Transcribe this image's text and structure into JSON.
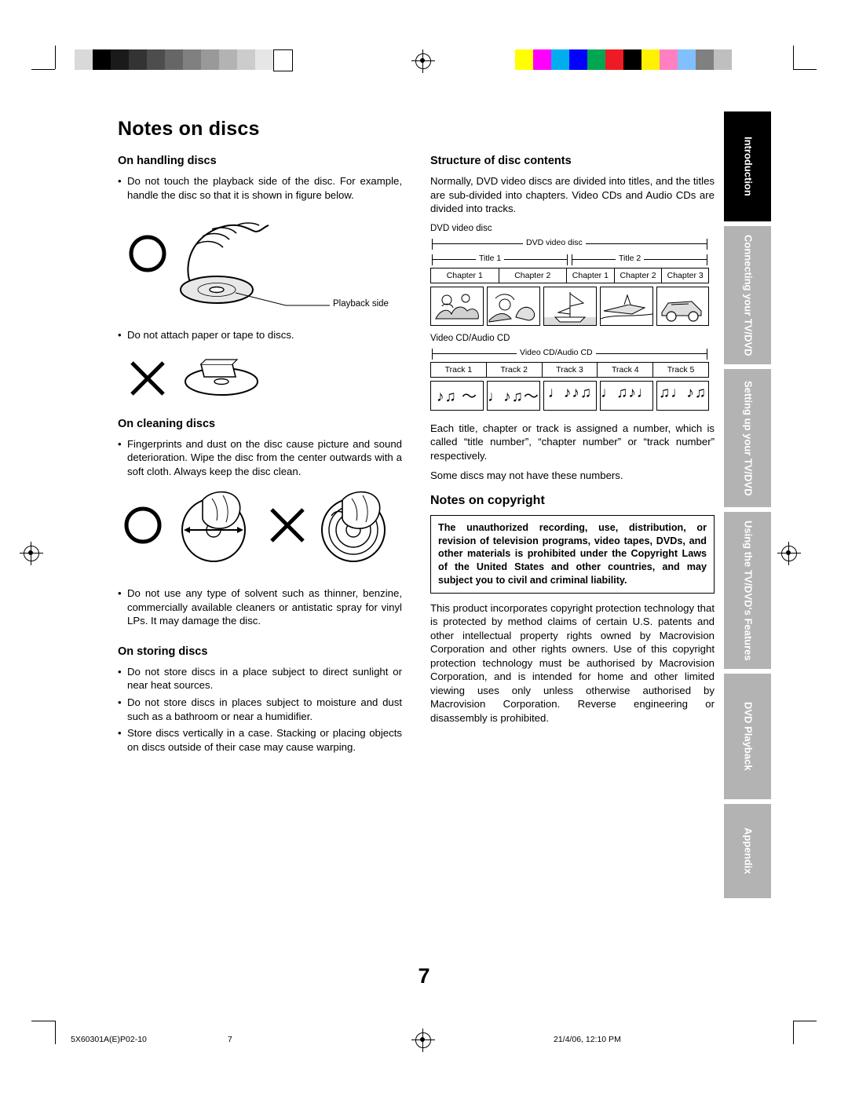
{
  "page": {
    "title": "Notes on discs",
    "number": "7"
  },
  "left": {
    "handling": {
      "heading": "On handling discs",
      "bullets": [
        "Do not touch the playback side of the disc. For example, handle the disc so that it is shown in figure below.",
        "Do not attach paper or tape to discs."
      ],
      "callout": "Playback side"
    },
    "cleaning": {
      "heading": "On cleaning discs",
      "bullets": [
        "Fingerprints and dust on the disc cause picture and sound deterioration. Wipe the disc from the center outwards with a soft cloth. Always keep the disc clean.",
        "Do not use any type of solvent such as thinner, benzine, commercially available cleaners or antistatic spray for vinyl LPs. It may damage the disc."
      ]
    },
    "storing": {
      "heading": "On storing discs",
      "bullets": [
        "Do not store discs in a place subject to direct sunlight or near heat sources.",
        "Do not store discs in places subject to moisture and dust such as a bathroom or near a humidifier.",
        "Store discs vertically in a case. Stacking or placing objects on discs outside of their case may cause warping."
      ]
    }
  },
  "right": {
    "structure": {
      "heading": "Structure of disc contents",
      "intro": "Normally, DVD video discs are divided into titles, and the titles are sub-divided into chapters. Video CDs and Audio CDs are divided into tracks.",
      "dvd_label": "DVD video disc",
      "dvd_diagram": {
        "top_caption": "DVD video disc",
        "titles": [
          "Title 1",
          "Title 2"
        ],
        "chapters": [
          "Chapter 1",
          "Chapter 2",
          "Chapter 1",
          "Chapter 2",
          "Chapter 3"
        ]
      },
      "cd_label": "Video CD/Audio CD",
      "cd_diagram": {
        "top_caption": "Video CD/Audio CD",
        "tracks": [
          "Track 1",
          "Track 2",
          "Track 3",
          "Track 4",
          "Track 5"
        ],
        "note_glyphs": [
          "♪♫ ～",
          "♩♪♫～",
          "♩♪♪♫～",
          "♩♫♪♩～",
          "♫♩♪♫～"
        ]
      },
      "after_text_1": "Each title, chapter or track is assigned a number, which is called “title number”, “chapter number” or “track number” respectively.",
      "after_text_2": "Some discs may not have these numbers."
    },
    "copyright": {
      "heading": "Notes on copyright",
      "boxed": "The unauthorized recording, use, distribution, or revision of television programs, video tapes, DVDs, and other materials is prohibited under the Copyright Laws of the United States and other countries, and may subject you to civil and criminal liability.",
      "body": "This product incorporates copyright protection technology that is protected by method claims of certain U.S. patents and other intellectual property rights owned by Macrovision Corporation and other rights owners. Use of this copyright protection technology must be authorised by Macrovision Corporation, and is intended for home and other limited viewing uses only unless otherwise authorised by Macrovision Corporation. Reverse engineering or disassembly is prohibited."
    }
  },
  "tabs": [
    {
      "label": "Introduction",
      "style": "dark"
    },
    {
      "label": "Connecting your TV/DVD",
      "style": "grey"
    },
    {
      "label": "Setting up your TV/DVD",
      "style": "grey"
    },
    {
      "label": "Using the TV/DVD's Features",
      "style": "grey"
    },
    {
      "label": "DVD Playback",
      "style": "grey"
    },
    {
      "label": "Appendix",
      "style": "grey"
    }
  ],
  "footer": {
    "file": "5X60301A(E)P02-10",
    "page": "7",
    "date": "21/4/06, 12:10 PM"
  },
  "marks": {
    "grey_swatches": [
      "#d9d9d9",
      "#000000",
      "#1a1a1a",
      "#333333",
      "#4d4d4d",
      "#666666",
      "#808080",
      "#999999",
      "#b3b3b3",
      "#cccccc",
      "#e6e6e6",
      "#ffffff"
    ],
    "color_swatches": [
      "#ffff00",
      "#ff00ff",
      "#00aeef",
      "#0000ff",
      "#00a651",
      "#ed1c24",
      "#000000",
      "#fff200",
      "#ff80c0",
      "#80c0ff",
      "#808080",
      "#bfbfbf"
    ]
  }
}
